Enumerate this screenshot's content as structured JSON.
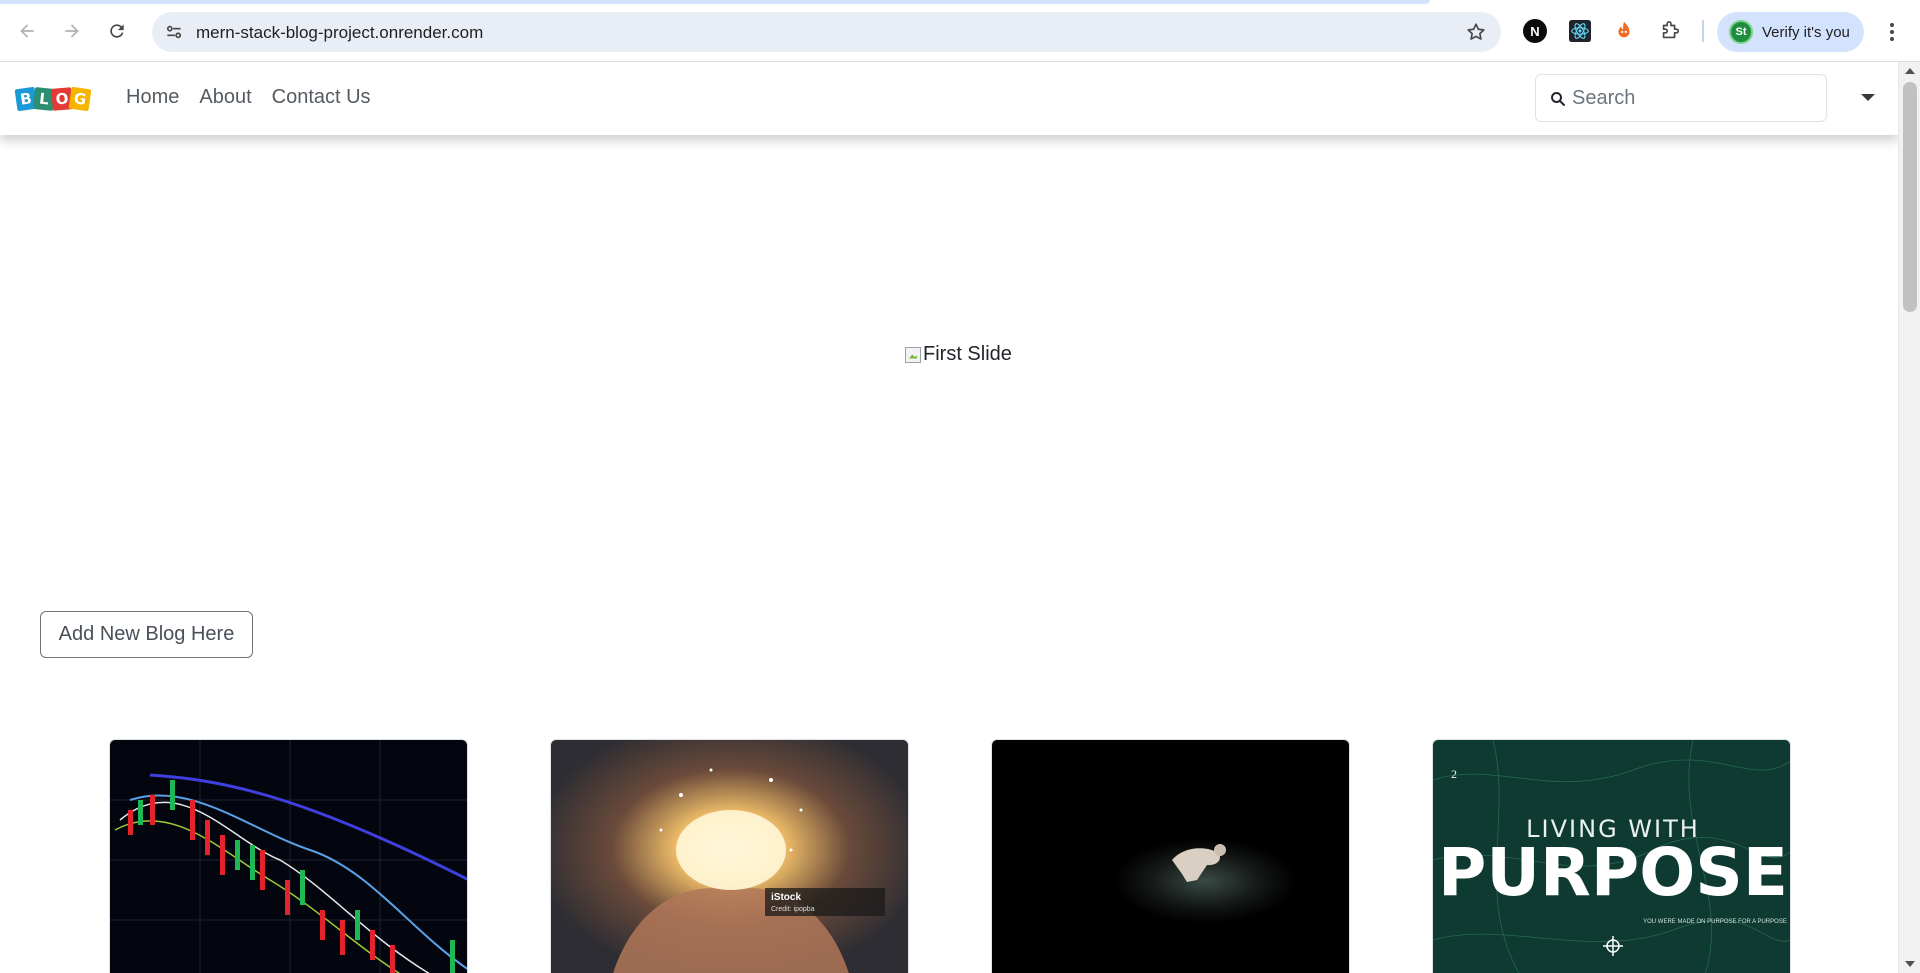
{
  "browser": {
    "url": "mern-stack-blog-project.onrender.com",
    "profile_chip_label": "Verify it's you",
    "profile_avatar_text": "St",
    "extensions": [
      "notion-icon",
      "react-devtools-icon",
      "fox-extension-icon",
      "extensions-puzzle-icon"
    ],
    "extension_n_letter": "N"
  },
  "navbar": {
    "brand_letters": [
      "B",
      "L",
      "O",
      "G"
    ],
    "brand_colors": [
      "#1a9bd7",
      "#2c8f6f",
      "#e53935",
      "#f5b400"
    ],
    "links": [
      "Home",
      "About",
      "Contact Us"
    ],
    "search_placeholder": "Search"
  },
  "carousel": {
    "image_alt": "First Slide"
  },
  "actions": {
    "add_blog_label": "Add New Blog Here"
  },
  "cards": [
    {
      "image": "stock-chart-image"
    },
    {
      "image": "glowing-hands-image",
      "watermark": "iStock",
      "watermark_credit": "Credit: ipopba"
    },
    {
      "image": "dark-stage-dancer-image"
    },
    {
      "image": "living-with-purpose-image",
      "title_small": "LIVING WITH",
      "title_big": "PURPOSE",
      "tagline": "YOU WERE MADE ON PURPOSE FOR A PURPOSE",
      "page_no": "2"
    }
  ]
}
